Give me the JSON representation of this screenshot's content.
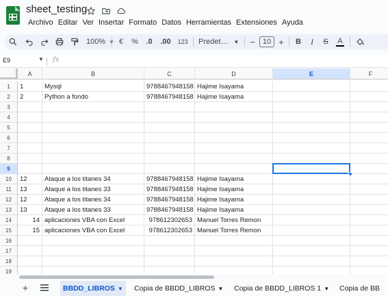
{
  "doc": {
    "title": "sheet_testing",
    "star_icon": "star-icon",
    "move_icon": "folder-move-icon",
    "cloud_icon": "cloud-status-icon"
  },
  "menu": [
    "Archivo",
    "Editar",
    "Ver",
    "Insertar",
    "Formato",
    "Datos",
    "Herramientas",
    "Extensiones",
    "Ayuda"
  ],
  "toolbar": {
    "zoom": "100%",
    "currency": "€",
    "percent": "%",
    "dec_decrease": ".0",
    "dec_increase": ".00",
    "format_123": "123",
    "font": "Predet…",
    "font_size": "10",
    "minus": "−",
    "plus": "+",
    "bold": "B",
    "italic": "I",
    "strike": "S",
    "text_color": "A"
  },
  "formula_bar": {
    "name_box": "E9",
    "fx": "fx"
  },
  "columns": [
    "A",
    "B",
    "C",
    "D",
    "E",
    "F"
  ],
  "active_column": "E",
  "active_row": "9",
  "rows": [
    {
      "n": "1",
      "a": "1",
      "a_align": "left",
      "b": "Mysql",
      "c": "9788467948158",
      "d": "Hajime Isayama"
    },
    {
      "n": "2",
      "a": "2",
      "a_align": "left",
      "b": "Python a fondo",
      "c": "9788467948158",
      "d": "Hajime Isayama"
    },
    {
      "n": "3",
      "a": "",
      "a_align": "left",
      "b": "",
      "c": "",
      "d": ""
    },
    {
      "n": "4",
      "a": "",
      "a_align": "left",
      "b": "",
      "c": "",
      "d": ""
    },
    {
      "n": "5",
      "a": "",
      "a_align": "left",
      "b": "",
      "c": "",
      "d": ""
    },
    {
      "n": "6",
      "a": "",
      "a_align": "left",
      "b": "",
      "c": "",
      "d": ""
    },
    {
      "n": "7",
      "a": "",
      "a_align": "left",
      "b": "",
      "c": "",
      "d": ""
    },
    {
      "n": "8",
      "a": "",
      "a_align": "left",
      "b": "",
      "c": "",
      "d": ""
    },
    {
      "n": "9",
      "a": "",
      "a_align": "left",
      "b": "",
      "c": "",
      "d": ""
    },
    {
      "n": "10",
      "a": "12",
      "a_align": "left",
      "b": "Ataque a los titanes 34",
      "c": "9788467948158",
      "d": "Hajime Isayama"
    },
    {
      "n": "11",
      "a": "13",
      "a_align": "left",
      "b": "Ataque a los titanes 33",
      "c": "9788467948158",
      "d": "Hajime Isayama"
    },
    {
      "n": "12",
      "a": "12",
      "a_align": "left",
      "b": "Ataque a los titanes 34",
      "c": "9788467948158",
      "d": "Hajime Isayama"
    },
    {
      "n": "13",
      "a": "13",
      "a_align": "left",
      "b": "Ataque a los titanes 33",
      "c": "9788467948158",
      "d": "Hajime Isayama"
    },
    {
      "n": "14",
      "a": "14",
      "a_align": "right",
      "b": "aplicaciones VBA con Excel",
      "c": "978612302653",
      "d": "Manuel Torres Remon"
    },
    {
      "n": "15",
      "a": "15",
      "a_align": "right",
      "b": "aplicaciones VBA con Excel",
      "c": "978612302653",
      "d": "Manuel Torres Remon"
    },
    {
      "n": "16",
      "a": "",
      "a_align": "left",
      "b": "",
      "c": "",
      "d": ""
    },
    {
      "n": "17",
      "a": "",
      "a_align": "left",
      "b": "",
      "c": "",
      "d": ""
    },
    {
      "n": "18",
      "a": "",
      "a_align": "left",
      "b": "",
      "c": "",
      "d": ""
    },
    {
      "n": "19",
      "a": "",
      "a_align": "left",
      "b": "",
      "c": "",
      "d": ""
    }
  ],
  "sheets": {
    "add_icon": "plus-icon",
    "list_icon": "menu-icon",
    "tabs": [
      {
        "label": "BBDD_LIBROS",
        "active": true
      },
      {
        "label": "Copia de BBDD_LIBROS",
        "active": false
      },
      {
        "label": "Copia de BBDD_LIBROS 1",
        "active": false
      },
      {
        "label": "Copia de BB",
        "active": false
      }
    ]
  }
}
